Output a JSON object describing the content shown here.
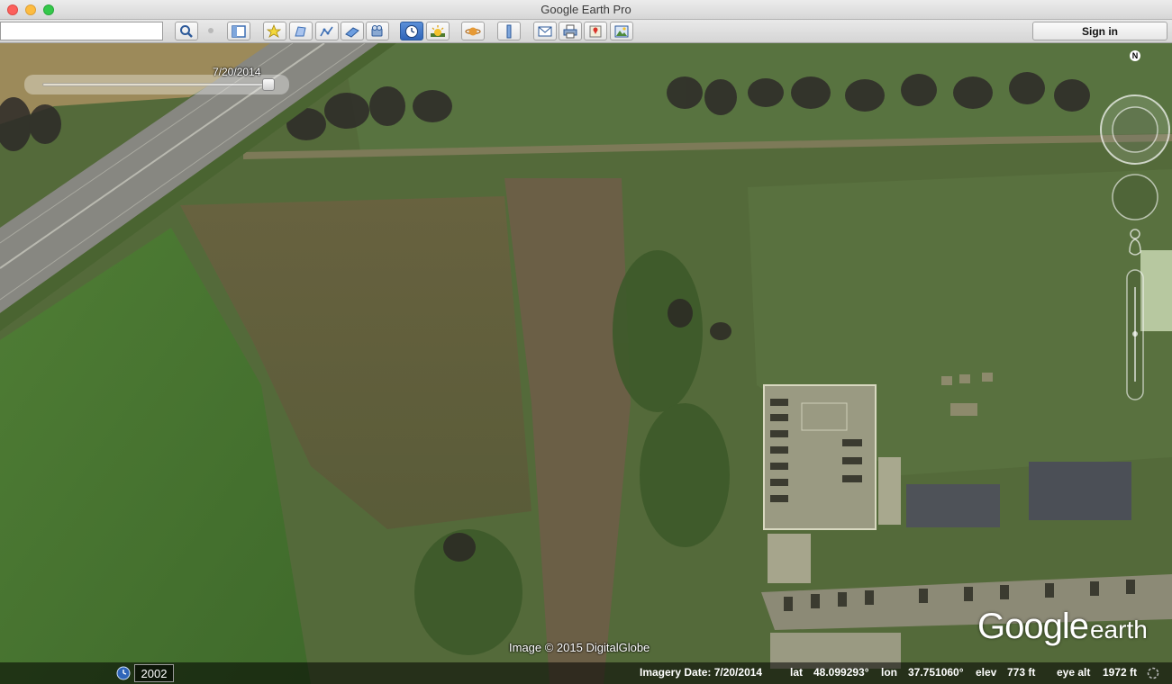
{
  "window": {
    "title": "Google Earth Pro"
  },
  "toolbar": {
    "search_value": "",
    "sign_in_label": "Sign in",
    "buttons": [
      {
        "name": "search-button",
        "icon": "magnifier-icon"
      },
      {
        "name": "sidebar-toggle-button",
        "icon": "sidebar-icon"
      },
      {
        "name": "add-placemark-button",
        "icon": "placemark-icon"
      },
      {
        "name": "add-polygon-button",
        "icon": "polygon-icon"
      },
      {
        "name": "add-path-button",
        "icon": "path-icon"
      },
      {
        "name": "image-overlay-button",
        "icon": "overlay-icon"
      },
      {
        "name": "record-tour-button",
        "icon": "tour-icon"
      },
      {
        "name": "historical-imagery-button",
        "icon": "clock-icon",
        "active": true
      },
      {
        "name": "sunlight-button",
        "icon": "sun-icon"
      },
      {
        "name": "planets-button",
        "icon": "planet-icon"
      },
      {
        "name": "ruler-button",
        "icon": "ruler-icon"
      },
      {
        "name": "email-button",
        "icon": "envelope-icon"
      },
      {
        "name": "print-button",
        "icon": "printer-icon"
      },
      {
        "name": "google-maps-button",
        "icon": "maps-icon"
      },
      {
        "name": "save-image-button",
        "icon": "image-icon"
      }
    ]
  },
  "time_slider": {
    "date_label": "7/20/2014",
    "position": 1.0
  },
  "compass": {
    "north_label": "N"
  },
  "map": {
    "copyright": "Image © 2015 DigitalGlobe",
    "logo_word1": "Google",
    "logo_word2": "earth"
  },
  "status_bar": {
    "year": "2002",
    "imagery_date": "Imagery Date: 7/20/2014",
    "lat_label": "lat",
    "lat_value": "48.099293°",
    "lon_label": "lon",
    "lon_value": "37.751060°",
    "elev_label": "elev",
    "elev_value": "773 ft",
    "eye_alt_label": "eye alt",
    "eye_alt_value": "1972 ft"
  },
  "colors": {
    "active_button": "#2f65b9",
    "field_green": "#4f7a36",
    "road_gray": "#8b8b86"
  }
}
